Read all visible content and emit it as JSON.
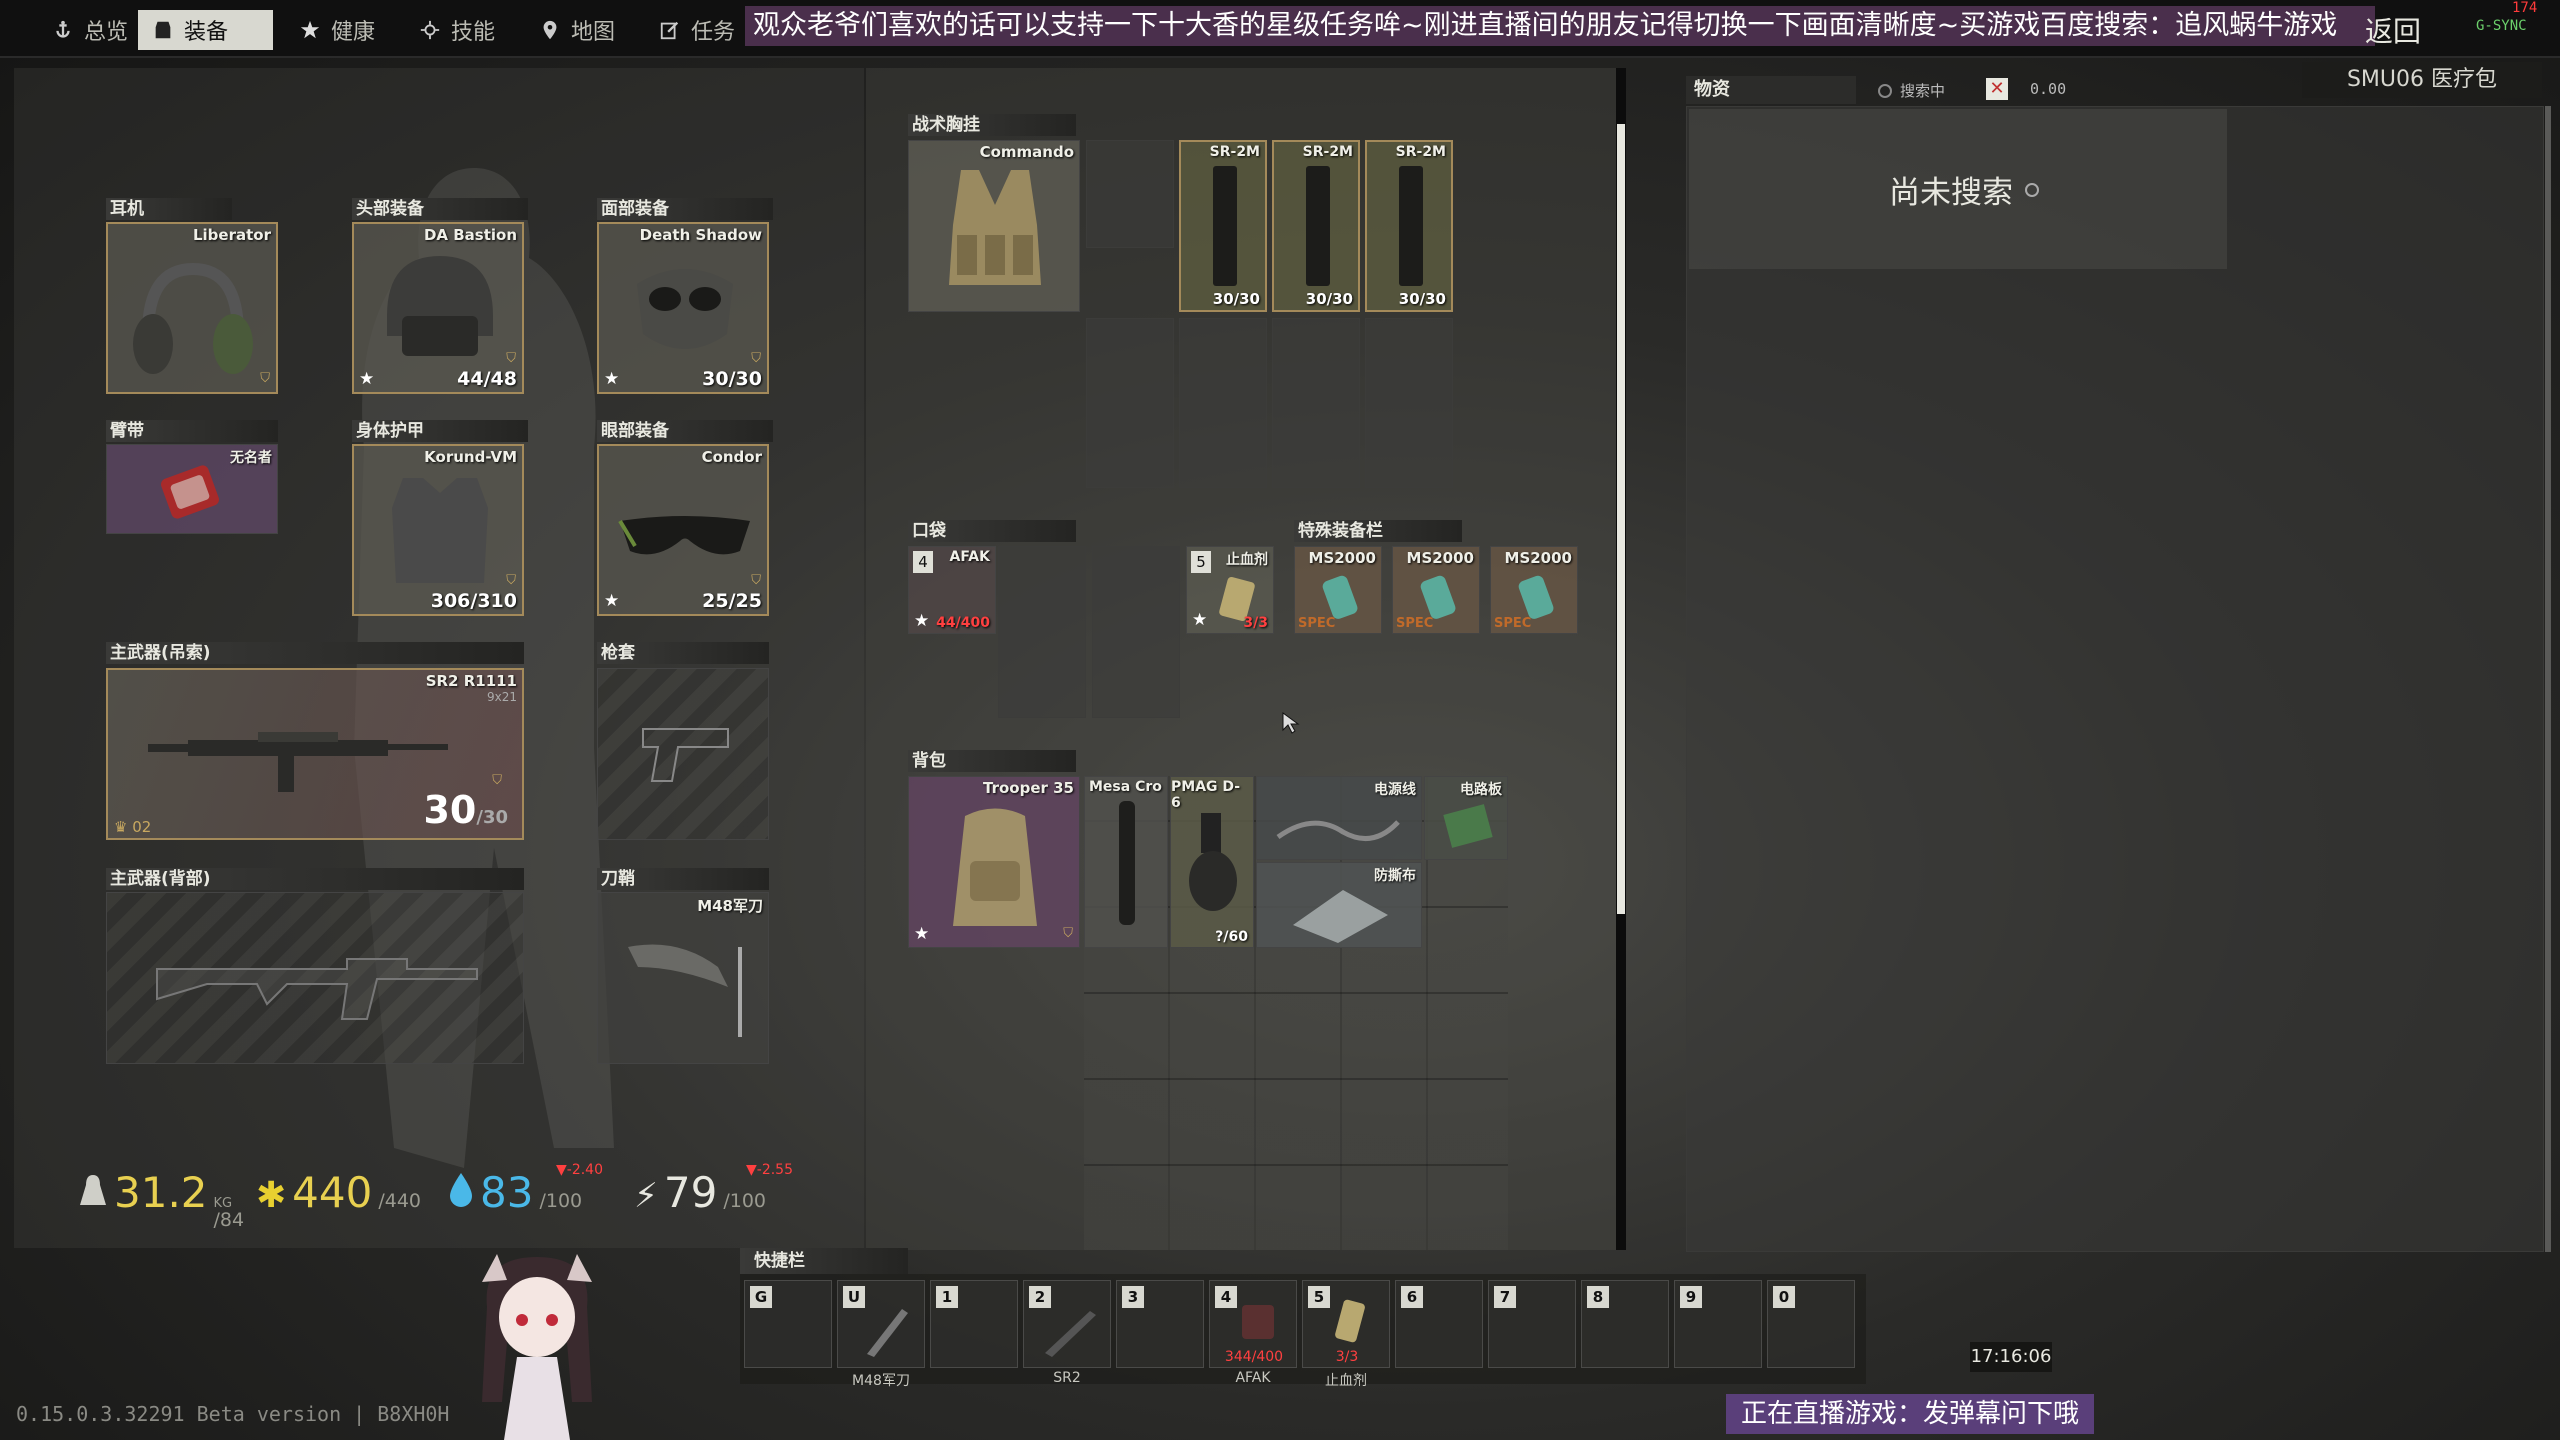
{
  "nav": {
    "tabs": [
      {
        "label": "总览",
        "icon": "anchor-icon"
      },
      {
        "label": "装备",
        "icon": "gear-equipment-icon"
      },
      {
        "label": "健康",
        "icon": "health-icon"
      },
      {
        "label": "技能",
        "icon": "skills-icon"
      },
      {
        "label": "地图",
        "icon": "map-pin-icon"
      },
      {
        "label": "任务",
        "icon": "task-edit-icon"
      }
    ],
    "active": "装备",
    "banner": "观众老爷们喜欢的话可以支持一下十大香的星级任务哞~刚进直播间的朋友记得切换一下画面清晰度~买游戏百度搜索：追风蜗牛游戏",
    "back_label": "返回",
    "gsync": "G-SYNC",
    "fps": "174"
  },
  "gear": {
    "earpiece": {
      "label": "耳机",
      "name": "Liberator"
    },
    "headwear": {
      "label": "头部装备",
      "name": "DA Bastion",
      "durability": "44/48"
    },
    "face": {
      "label": "面部装备",
      "name": "Death Shadow",
      "durability": "30/30"
    },
    "armband": {
      "label": "臂带",
      "name": "无名者"
    },
    "armor": {
      "label": "身体护甲",
      "name": "Korund-VM",
      "durability": "306/310"
    },
    "eyewear": {
      "label": "眼部装备",
      "name": "Condor",
      "durability": "25/25"
    },
    "primary_sling": {
      "label": "主武器(吊索)",
      "name": "SR2 R1111",
      "caliber": "9x21",
      "ammo": "30",
      "ammo_max": "/30",
      "mark": "02"
    },
    "holster": {
      "label": "枪套"
    },
    "primary_back": {
      "label": "主武器(背部)"
    },
    "scabbard": {
      "label": "刀鞘",
      "name": "M48军刀"
    }
  },
  "rig": {
    "label": "战术胸挂",
    "name": "Commando",
    "mags": [
      {
        "name": "SR-2M",
        "count": "30/30"
      },
      {
        "name": "SR-2M",
        "count": "30/30"
      },
      {
        "name": "SR-2M",
        "count": "30/30"
      }
    ]
  },
  "pockets": {
    "label": "口袋",
    "items": [
      {
        "slot": "4",
        "name": "AFAK",
        "value": "44/400"
      },
      {
        "slot": "5",
        "name": "止血剂",
        "value": "3/3"
      }
    ]
  },
  "special": {
    "label": "特殊装备栏",
    "items": [
      {
        "name": "MS2000",
        "tag": "SPEC"
      },
      {
        "name": "MS2000",
        "tag": "SPEC"
      },
      {
        "name": "MS2000",
        "tag": "SPEC"
      }
    ]
  },
  "backpack": {
    "label": "背包",
    "name": "Trooper 35",
    "items": [
      {
        "name": "Mesa Cro"
      },
      {
        "name": "PMAG D-6",
        "count": "?/60"
      },
      {
        "name": "电源线"
      },
      {
        "name": "电路板"
      },
      {
        "name": "防撕布"
      }
    ]
  },
  "stats": {
    "weight": "31.2",
    "weight_unit": "KG",
    "weight_max": "/84",
    "health": "440",
    "health_max": "/440",
    "hydration": "83",
    "hydration_max": "/100",
    "hydration_rate": "▼-2.40",
    "energy": "79",
    "energy_max": "/100",
    "energy_rate": "▼-2.55"
  },
  "loot": {
    "tab_label": "物资",
    "searching_label": "搜索中",
    "timer": "0.00",
    "container_name": "SMU06 医疗包",
    "not_searched": "尚未搜索"
  },
  "hotbar": {
    "label": "快捷栏",
    "slots": [
      {
        "key": "G",
        "item": ""
      },
      {
        "key": "U",
        "item": "M48军刀"
      },
      {
        "key": "1",
        "item": ""
      },
      {
        "key": "2",
        "item": "SR2"
      },
      {
        "key": "3",
        "item": ""
      },
      {
        "key": "4",
        "item": "AFAK",
        "value": "344/400"
      },
      {
        "key": "5",
        "item": "止血剂",
        "value": "3/3"
      },
      {
        "key": "6",
        "item": ""
      },
      {
        "key": "7",
        "item": ""
      },
      {
        "key": "8",
        "item": ""
      },
      {
        "key": "9",
        "item": ""
      },
      {
        "key": "0",
        "item": ""
      }
    ]
  },
  "footer": {
    "version": "0.15.0.3.32291 Beta version | B8XH0H",
    "clock": "17:16:06",
    "stream_notice": "正在直播游戏：发弹幕问下哦"
  }
}
